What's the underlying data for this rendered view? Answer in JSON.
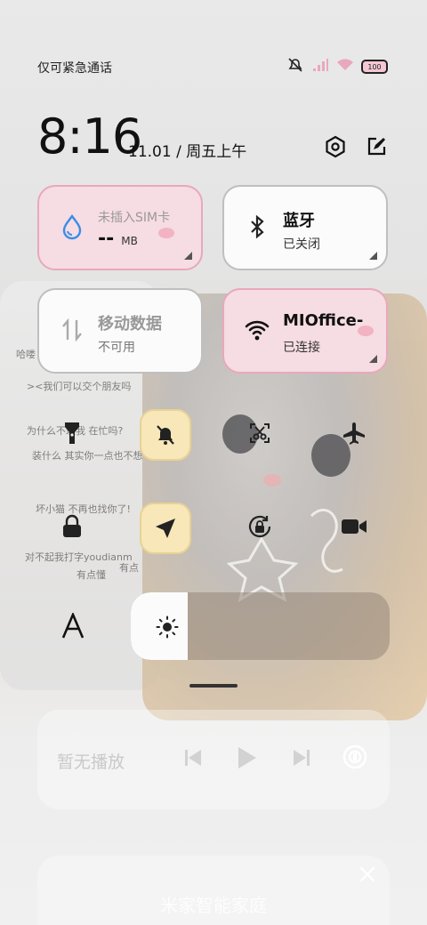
{
  "status_bar": {
    "carrier_text": "仅可紧急通话",
    "battery": "100"
  },
  "header": {
    "time": "8:16",
    "date": "11.01 / 周五上午"
  },
  "tiles": {
    "sim": {
      "title": "未插入SIM卡",
      "value": "--",
      "unit": "MB"
    },
    "bluetooth": {
      "title": "蓝牙",
      "status": "已关闭"
    },
    "mobile_data": {
      "title": "移动数据",
      "status": "不可用"
    },
    "wifi": {
      "title": "MIOffice-",
      "status": "已连接"
    }
  },
  "background_chat": [
    "哈喽",
    "><我们可以交个朋友吗",
    "为什么不理我 在忙吗?",
    "装什么 其实你一点也不想",
    "坏小猫 不再也找你了!",
    "对不起我打字youdianm"
  ],
  "keyboard_hints": [
    "有点懂",
    "有点"
  ],
  "brightness": {
    "level_percent": 22
  },
  "media": {
    "title": "暂无播放"
  },
  "smart_home": {
    "title": "米家智能家庭"
  },
  "colors": {
    "accent_pink": "#e9a8bb",
    "water_blue": "#3a8ee6"
  }
}
